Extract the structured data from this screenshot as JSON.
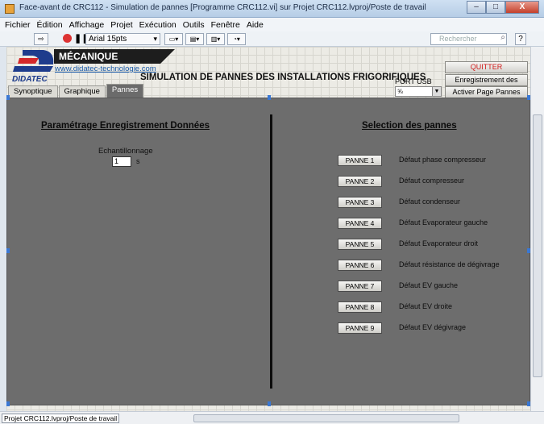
{
  "window": {
    "title": "Face-avant de CRC112 - Simulation de pannes [Programme CRC112.vi] sur Projet CRC112.lvproj/Poste de travail",
    "minimize": "–",
    "maximize": "□",
    "close": "X"
  },
  "menu": [
    "Fichier",
    "Édition",
    "Affichage",
    "Projet",
    "Exécution",
    "Outils",
    "Fenêtre",
    "Aide"
  ],
  "toolbar": {
    "font": "Arial 15pts",
    "search_placeholder": "Rechercher",
    "help": "?"
  },
  "header": {
    "brand_banner": "MÉCANIQUE APPLIQUÉE",
    "logo_text": "DIDATEC",
    "website": "www.didatec-technologie.com",
    "title": "SIMULATION DE PANNES DES INSTALLATIONS FRIGORIFIQUES",
    "port_label": "PORT USB",
    "port_value": "⅝",
    "quit": "QUITTER",
    "record": "Enregistrement des données",
    "activate": "Activer Page Pannes"
  },
  "tabs": [
    {
      "label": "Synoptique",
      "active": false
    },
    {
      "label": "Graphique",
      "active": false
    },
    {
      "label": "Pannes",
      "active": true
    }
  ],
  "left_panel": {
    "title": "Paramétrage Enregistrement Données",
    "echantillonnage_label": "Echantillonnage",
    "echantillonnage_value": "1",
    "unit": "s"
  },
  "right_panel": {
    "title": "Selection des pannes",
    "faults": [
      {
        "button": "PANNE 1",
        "label": "Défaut phase compresseur"
      },
      {
        "button": "PANNE 2",
        "label": "Défaut compresseur"
      },
      {
        "button": "PANNE 3",
        "label": "Défaut condenseur"
      },
      {
        "button": "PANNE 4",
        "label": "Défaut Evaporateur gauche"
      },
      {
        "button": "PANNE 5",
        "label": "Défaut Evaporateur droit"
      },
      {
        "button": "PANNE 6",
        "label": "Défaut résistance de dégivrage"
      },
      {
        "button": "PANNE 7",
        "label": "Défaut EV gauche"
      },
      {
        "button": "PANNE 8",
        "label": "Défaut EV droite"
      },
      {
        "button": "PANNE 9",
        "label": "Défaut EV dégivrage"
      }
    ]
  },
  "status": {
    "project": "Projet CRC112.lvproj/Poste de travail"
  },
  "colors": {
    "quit_text": "#d21b1b",
    "panel_background": "#6d6d6d",
    "link": "#1a5aa8"
  }
}
